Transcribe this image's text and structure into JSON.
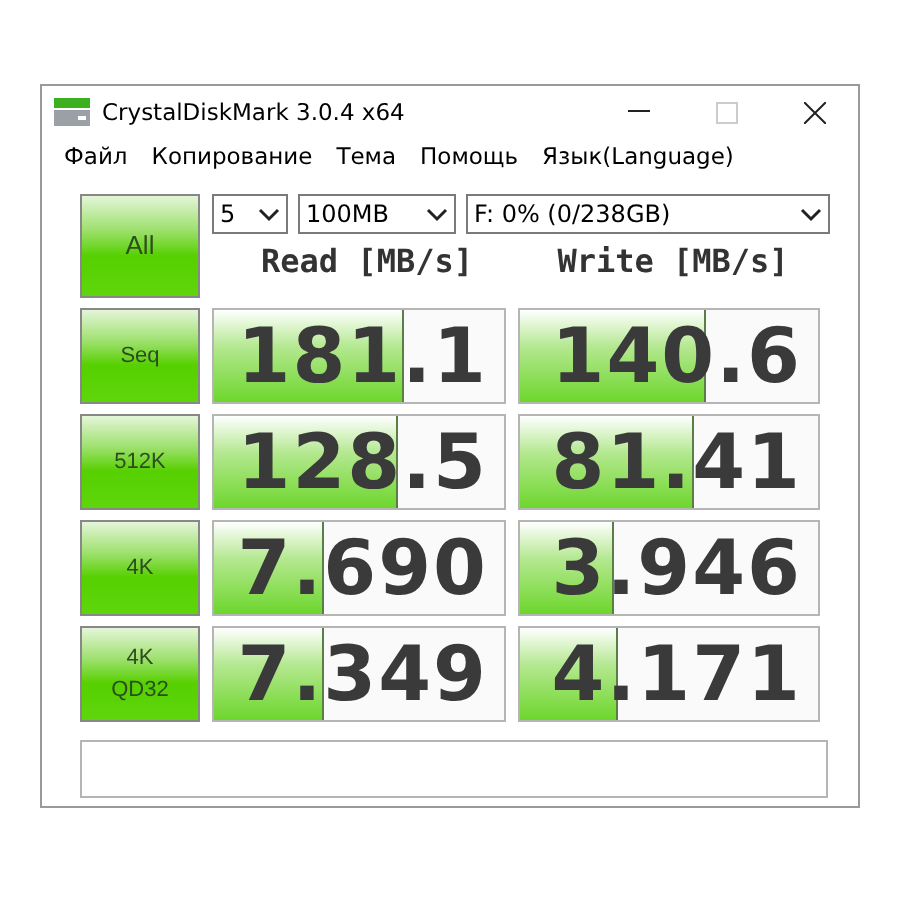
{
  "window": {
    "title": "CrystalDiskMark 3.0.4 x64"
  },
  "menu": [
    "Файл",
    "Копирование",
    "Тема",
    "Помощь",
    "Язык(Language)"
  ],
  "all_button": "All",
  "controls": {
    "count": "5",
    "size": "100MB",
    "drive": "F: 0% (0/238GB)"
  },
  "headers": {
    "read": "Read [MB/s]",
    "write": "Write [MB/s]"
  },
  "rows": [
    {
      "label": "Seq",
      "read": {
        "value": "181.1",
        "level": 0.65
      },
      "write": {
        "value": "140.6",
        "level": 0.62
      }
    },
    {
      "label": "512K",
      "read": {
        "value": "128.5",
        "level": 0.63
      },
      "write": {
        "value": "81.41",
        "level": 0.58
      }
    },
    {
      "label": "4K",
      "read": {
        "value": "7.690",
        "level": 0.37
      },
      "write": {
        "value": "3.946",
        "level": 0.31
      }
    },
    {
      "label": "4K\nQD32",
      "read": {
        "value": "7.349",
        "level": 0.37
      },
      "write": {
        "value": "4.171",
        "level": 0.32
      }
    }
  ]
}
